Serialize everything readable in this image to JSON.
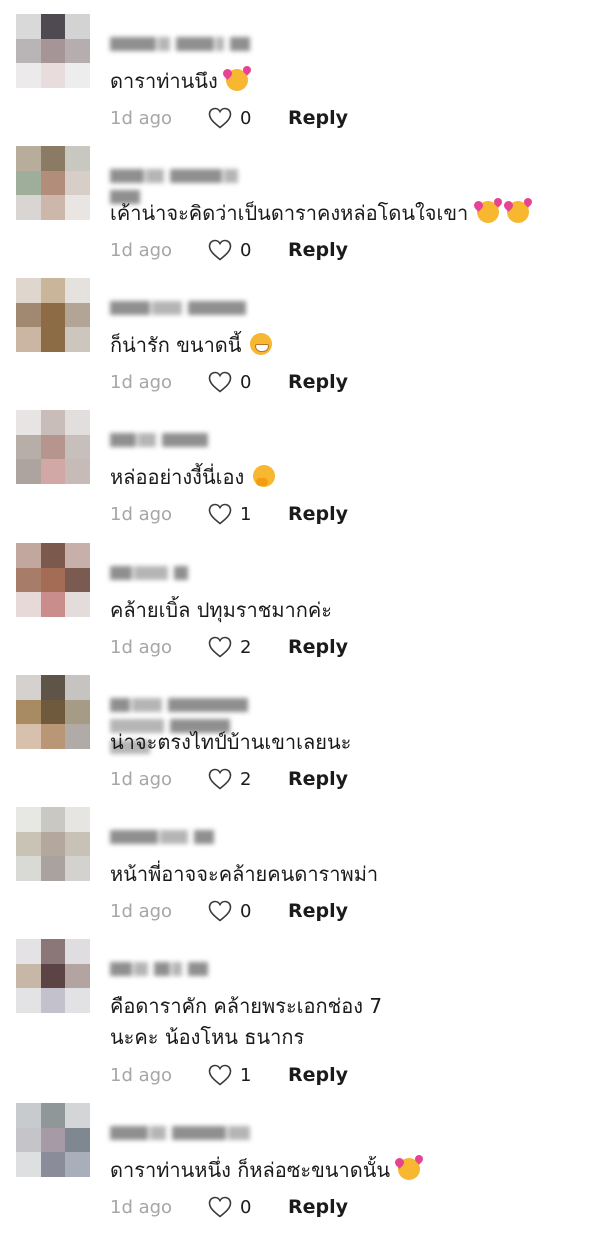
{
  "comments": [
    {
      "text": "ดาราท่านนึง",
      "emoji": "smiling-face-with-hearts",
      "age": "1d ago",
      "likes": "0",
      "reply": "Reply",
      "avatar": [
        "#d9d9d9",
        "#4f4a52",
        "#d3d3d3",
        "#b9b5b7",
        "#a69597",
        "#b5adae",
        "#eceaea",
        "#e8dcdc",
        "#eeeded"
      ]
    },
    {
      "text": "เค้าน่าจะคิดว่าเป็นดาราคงหล่อโดนใจเขา",
      "emoji": "smiling-face-with-hearts",
      "emoji2": "smiling-face-with-hearts",
      "age": "1d ago",
      "likes": "0",
      "reply": "Reply",
      "avatar": [
        "#b8ad9a",
        "#8c7b64",
        "#c9c8c0",
        "#9fae9a",
        "#b18d7a",
        "#d7cfc7",
        "#d8d5d3",
        "#cdb7ab",
        "#e9e5e3"
      ]
    },
    {
      "text": "ก็น่ารัก ขนาดนี้",
      "emoji": "grinning-face",
      "age": "1d ago",
      "likes": "0",
      "reply": "Reply",
      "avatar": [
        "#dfd6ce",
        "#c9b69a",
        "#e5e1dc",
        "#a08970",
        "#8c6b45",
        "#b3a596",
        "#cab6a2",
        "#8c6c44",
        "#ccc6bf"
      ]
    },
    {
      "text": "หล่ออย่างงี้นี่เอง",
      "emoji": "hand-over-mouth",
      "age": "1d ago",
      "likes": "1",
      "reply": "Reply",
      "avatar": [
        "#e7e4e3",
        "#c8bdb9",
        "#e2dedd",
        "#b7aea8",
        "#b5958e",
        "#c6bfbb",
        "#aea49f",
        "#d1a8a6",
        "#c7bbb7"
      ]
    },
    {
      "text": "คล้ายเบิ้ล ปทุมราชมากค่ะ",
      "emoji": "",
      "age": "1d ago",
      "likes": "2",
      "reply": "Reply",
      "avatar": [
        "#c1a79e",
        "#7b5a4d",
        "#c7afaa",
        "#a77d6a",
        "#a46b55",
        "#7a5a51",
        "#e7d9d7",
        "#c98d8c",
        "#e4dcdb"
      ]
    },
    {
      "text": "น่าจะตรงไทป์บ้านเขาเลยนะ",
      "emoji": "",
      "age": "1d ago",
      "likes": "2",
      "reply": "Reply",
      "avatar": [
        "#d4d1cf",
        "#5e5448",
        "#c7c3c0",
        "#a88a63",
        "#6f5a3d",
        "#a69c86",
        "#d7c0ac",
        "#b89676",
        "#b0aba6"
      ]
    },
    {
      "text": "หน้าพี่อาจจะคล้ายคนดาราพม่า",
      "emoji": "",
      "age": "1d ago",
      "likes": "0",
      "reply": "Reply",
      "avatar": [
        "#e7e7e3",
        "#c9c8c3",
        "#e7e5e1",
        "#c9c3b6",
        "#b4a89e",
        "#c8c2b6",
        "#d9d9d5",
        "#a9a29f",
        "#d4d2ce"
      ]
    },
    {
      "text": "คือดาราคัก คล้ายพระเอกช่อง 7\nนะคะ น้องโหน ธนากร",
      "emoji": "",
      "age": "1d ago",
      "likes": "1",
      "reply": "Reply",
      "avatar": [
        "#e4e2e4",
        "#8b7778",
        "#dfdde0",
        "#c7b7a7",
        "#5c4444",
        "#b3a3a1",
        "#e3e2e5",
        "#c3c2cc",
        "#e2e1e4"
      ]
    },
    {
      "text": "ดาราท่านหนึ่ง ก็หล่อซะขนาดนั้น",
      "emoji": "smiling-face-with-hearts",
      "age": "1d ago",
      "likes": "0",
      "reply": "Reply",
      "avatar": [
        "#c7cbcd",
        "#8f9799",
        "#d3d5d6",
        "#c4c4c9",
        "#a59aa5",
        "#7f8890",
        "#dedfe0",
        "#8a8d99",
        "#a9aebb"
      ]
    }
  ]
}
